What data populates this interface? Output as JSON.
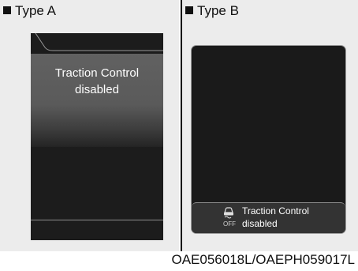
{
  "type_a": {
    "label": "Type A",
    "message_line1": "Traction Control",
    "message_line2": "disabled"
  },
  "type_b": {
    "label": "Type B",
    "message_line1": "Traction Control",
    "message_line2": "disabled",
    "icon": "traction-control-off-icon",
    "icon_text": "OFF"
  },
  "caption": "OAE056018L/OAEPH059017L"
}
